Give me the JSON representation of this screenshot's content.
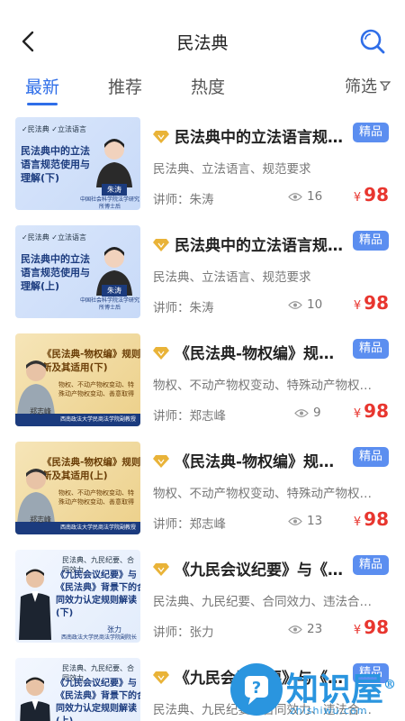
{
  "header": {
    "title": "民法典",
    "back_icon": "back-arrow-icon",
    "search_icon": "search-icon"
  },
  "tabs": {
    "items": [
      {
        "label": "最新",
        "active": true
      },
      {
        "label": "推荐",
        "active": false
      },
      {
        "label": "热度",
        "active": false
      }
    ],
    "filter_label": "筛选",
    "accent": "#2f6ee8"
  },
  "courses": [
    {
      "title": "民法典中的立法语言规…",
      "badge": "精品",
      "tags": "民法典、立法语言、规范要求",
      "teacher": "讲师：朱涛",
      "views": "16",
      "currency": "¥",
      "price": "98",
      "thumb": {
        "style": "blue",
        "tags": "✓民法典 ✓立法语言",
        "text": "民法典中的立法语言规范使用与理解(下)",
        "name": "朱涛",
        "org": "中国社会科学院法学研究所博士后"
      }
    },
    {
      "title": "民法典中的立法语言规…",
      "badge": "精品",
      "tags": "民法典、立法语言、规范要求",
      "teacher": "讲师：朱涛",
      "views": "10",
      "currency": "¥",
      "price": "98",
      "thumb": {
        "style": "blue",
        "tags": "✓民法典 ✓立法语言",
        "text": "民法典中的立法语言规范使用与理解(上)",
        "name": "朱涛",
        "org": "中国社会科学院法学研究所博士后"
      }
    },
    {
      "title": "《民法典-物权编》规则…",
      "badge": "精品",
      "tags": "物权、不动产物权变动、特殊动产物权变…",
      "teacher": "讲师：郑志峰",
      "views": "9",
      "currency": "¥",
      "price": "98",
      "thumb": {
        "style": "gold",
        "text": "《民法典-物权编》规则创新及其适用(下)",
        "sub": "物权、不动产物权变动、特殊动产物权变动、善意取得",
        "name": "郑志峰",
        "org": "西南政法大学民商法学院副教授"
      }
    },
    {
      "title": "《民法典-物权编》规则…",
      "badge": "精品",
      "tags": "物权、不动产物权变动、特殊动产物权变…",
      "teacher": "讲师：郑志峰",
      "views": "13",
      "currency": "¥",
      "price": "98",
      "thumb": {
        "style": "gold",
        "text": "《民法典-物权编》规则创新及其适用(上)",
        "sub": "物权、不动产物权变动、特殊动产物权变动、善意取得",
        "name": "郑志峰",
        "org": "西南政法大学民商法学院副教授"
      }
    },
    {
      "title": "《九民会议纪要》与《…",
      "badge": "精品",
      "tags": "民法典、九民纪要、合同效力、违法合同…",
      "teacher": "讲师：张力",
      "views": "23",
      "currency": "¥",
      "price": "98",
      "thumb": {
        "style": "white",
        "tags": "民法典、九民纪要、合同效力",
        "text": "《九民会议纪要》与《民法典》背景下的合同效力认定规则解读(下)",
        "name": "张力",
        "org": "西南政法大学民商法学院副院长"
      }
    },
    {
      "title": "《九民会议纪要》与《…",
      "badge": "精品",
      "tags": "民法典、九民纪要、合同效力、违法合同…",
      "teacher": "",
      "views": "",
      "currency": "",
      "price": "",
      "thumb": {
        "style": "white",
        "tags": "民法典、九民纪要、合同效力",
        "text": "《九民会议纪要》与《民法典》背景下的合同效力认定规则解读(上)",
        "name": "",
        "org": ""
      }
    }
  ],
  "watermark": {
    "text": "知识屋",
    "url": "zhishiwu.com",
    "mark": "®"
  },
  "colors": {
    "price": "#e8362f",
    "badge": "#5b8ef0",
    "diamond": "#e9b338"
  }
}
